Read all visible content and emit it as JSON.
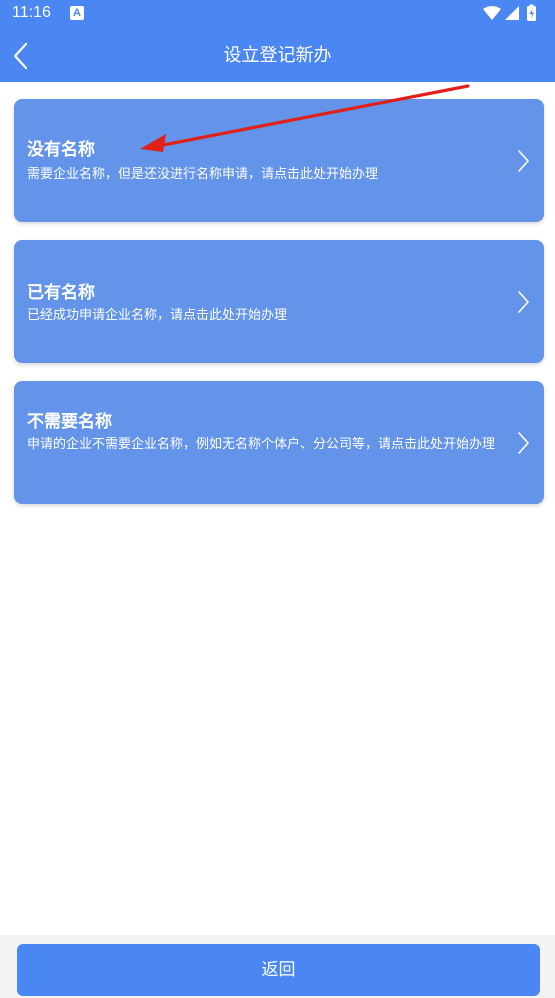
{
  "status": {
    "time": "11:16",
    "notify_letter": "A"
  },
  "header": {
    "title": "设立登记新办"
  },
  "options": [
    {
      "title": "没有名称",
      "desc": "需要企业名称，但是还没进行名称申请，请点击此处开始办理"
    },
    {
      "title": "已有名称",
      "desc": "已经成功申请企业名称，请点击此处开始办理"
    },
    {
      "title": "不需要名称",
      "desc": "申请的企业不需要企业名称，例如无名称个体户、分公司等，请点击此处开始办理"
    }
  ],
  "footer": {
    "back_label": "返回"
  },
  "colors": {
    "primary": "#4a87f2",
    "card": "#6394e9",
    "annotation": "#e0201b"
  }
}
